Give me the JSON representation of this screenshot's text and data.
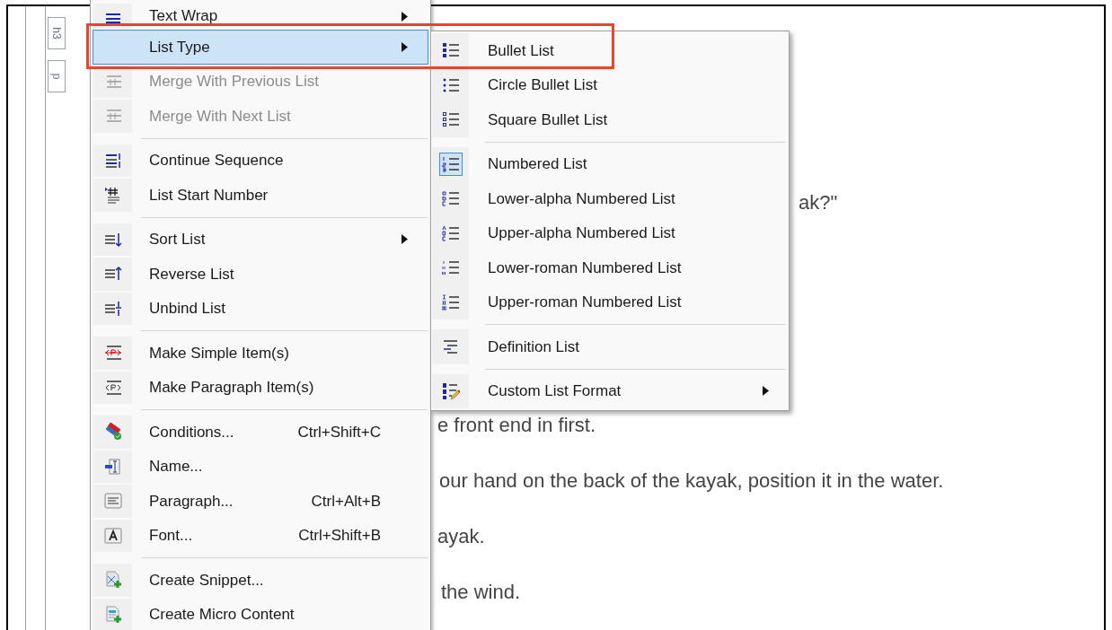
{
  "gutter_tags": [
    "h3",
    "p"
  ],
  "document_lines": [
    "ak?\"",
    "e front end in first.",
    "our hand on the back of the kayak, position it in the water.",
    "ayak.",
    "the wind."
  ],
  "context_menu": {
    "groups": [
      [
        {
          "label": "Text Wrap",
          "has_submenu": true,
          "disabled": false,
          "selected": false
        },
        {
          "label": "List Type",
          "has_submenu": true,
          "disabled": false,
          "selected": true
        },
        {
          "label": "Merge With Previous List",
          "has_submenu": false,
          "disabled": true,
          "selected": false
        },
        {
          "label": "Merge With Next List",
          "has_submenu": false,
          "disabled": true,
          "selected": false
        }
      ],
      [
        {
          "label": "Continue Sequence",
          "has_submenu": false,
          "disabled": false,
          "selected": false
        },
        {
          "label": "List Start Number",
          "has_submenu": false,
          "disabled": false,
          "selected": false
        }
      ],
      [
        {
          "label": "Sort List",
          "has_submenu": true,
          "disabled": false,
          "selected": false
        },
        {
          "label": "Reverse List",
          "has_submenu": false,
          "disabled": false,
          "selected": false
        },
        {
          "label": "Unbind List",
          "has_submenu": false,
          "disabled": false,
          "selected": false
        }
      ],
      [
        {
          "label": "Make Simple Item(s)",
          "has_submenu": false,
          "disabled": false,
          "selected": false
        },
        {
          "label": "Make Paragraph Item(s)",
          "has_submenu": false,
          "disabled": false,
          "selected": false
        }
      ],
      [
        {
          "label": "Conditions...",
          "shortcut": "Ctrl+Shift+C",
          "has_submenu": false,
          "disabled": false,
          "selected": false
        },
        {
          "label": "Name...",
          "has_submenu": false,
          "disabled": false,
          "selected": false
        },
        {
          "label": "Paragraph...",
          "shortcut": "Ctrl+Alt+B",
          "has_submenu": false,
          "disabled": false,
          "selected": false
        },
        {
          "label": "Font...",
          "shortcut": "Ctrl+Shift+B",
          "has_submenu": false,
          "disabled": false,
          "selected": false
        }
      ],
      [
        {
          "label": "Create Snippet...",
          "has_submenu": false,
          "disabled": false,
          "selected": false
        },
        {
          "label": "Create Micro Content",
          "has_submenu": false,
          "disabled": false,
          "selected": false
        }
      ]
    ]
  },
  "submenu": {
    "groups": [
      [
        {
          "label": "Bullet List",
          "checked": false,
          "has_submenu": false
        },
        {
          "label": "Circle Bullet List",
          "checked": false,
          "has_submenu": false
        },
        {
          "label": "Square Bullet List",
          "checked": false,
          "has_submenu": false
        }
      ],
      [
        {
          "label": "Numbered List",
          "checked": true,
          "has_submenu": false
        },
        {
          "label": "Lower-alpha Numbered List",
          "checked": false,
          "has_submenu": false
        },
        {
          "label": "Upper-alpha Numbered List",
          "checked": false,
          "has_submenu": false
        },
        {
          "label": "Lower-roman Numbered List",
          "checked": false,
          "has_submenu": false
        },
        {
          "label": "Upper-roman Numbered List",
          "checked": false,
          "has_submenu": false
        }
      ],
      [
        {
          "label": "Definition List",
          "checked": false,
          "has_submenu": false
        }
      ],
      [
        {
          "label": "Custom List Format",
          "checked": false,
          "has_submenu": true
        }
      ]
    ]
  }
}
